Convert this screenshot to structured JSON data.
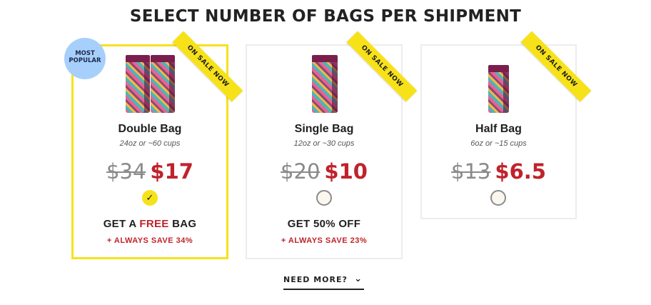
{
  "title": "SELECT NUMBER OF BAGS PER SHIPMENT",
  "popular_badge": "MOST POPULAR",
  "ribbon_label": "ON SALE NOW",
  "plans": [
    {
      "name": "Double Bag",
      "size": "24oz or ~60 cups",
      "old_price": "$34",
      "new_price": "$17",
      "selected": true,
      "offer_prefix": "GET A ",
      "offer_highlight": "FREE",
      "offer_suffix": " BAG",
      "savings": "+ ALWAYS SAVE 34%"
    },
    {
      "name": "Single Bag",
      "size": "12oz or ~30 cups",
      "old_price": "$20",
      "new_price": "$10",
      "selected": false,
      "offer": "GET 50% OFF",
      "savings": "+ ALWAYS SAVE 23%"
    },
    {
      "name": "Half Bag",
      "size": "6oz or ~15 cups",
      "old_price": "$13",
      "new_price": "$6.5",
      "selected": false
    }
  ],
  "need_more_label": "NEED MORE?",
  "colors": {
    "accent_yellow": "#f5e21c",
    "price_red": "#c0222b",
    "badge_blue": "#a6d0fb"
  }
}
